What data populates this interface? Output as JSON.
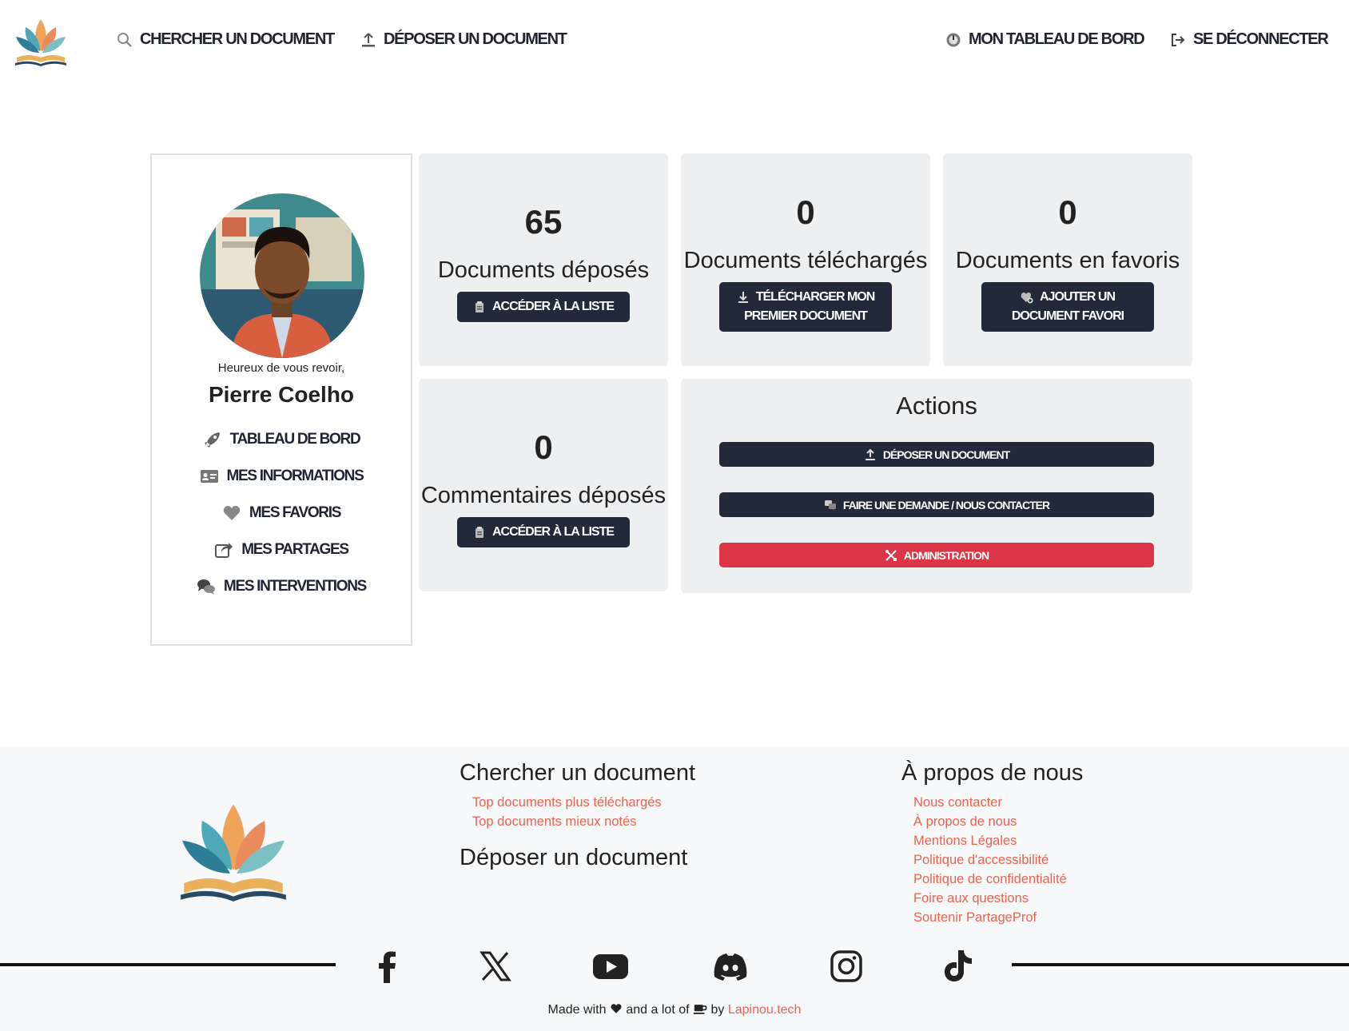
{
  "nav": {
    "search": "CHERCHER UN DOCUMENT",
    "upload": "DÉPOSER UN DOCUMENT",
    "dashboard": "MON TABLEAU DE BORD",
    "logout": "SE DÉCONNECTER"
  },
  "profile": {
    "greeting": "Heureux de vous revoir,",
    "name": "Pierre Coelho",
    "menu": [
      "TABLEAU DE BORD",
      "MES INFORMATIONS",
      "MES FAVORIS",
      "MES PARTAGES",
      "MES INTERVENTIONS"
    ]
  },
  "stats": {
    "uploaded": {
      "count": "65",
      "label": "Documents déposés",
      "button": "ACCÉDER À LA LISTE"
    },
    "downloaded": {
      "count": "0",
      "label": "Documents téléchargés",
      "button_line1": "TÉLÉCHARGER MON",
      "button_line2": "PREMIER DOCUMENT"
    },
    "favorites": {
      "count": "0",
      "label": "Documents en favoris",
      "button_line1": "AJOUTER UN",
      "button_line2": "DOCUMENT FAVORI"
    },
    "comments": {
      "count": "0",
      "label": "Commentaires déposés",
      "button": "ACCÉDER À LA LISTE"
    }
  },
  "actions": {
    "title": "Actions",
    "upload": "DÉPOSER UN DOCUMENT",
    "contact": "FAIRE UNE DEMANDE / NOUS CONTACTER",
    "admin": "ADMINISTRATION"
  },
  "footer": {
    "search_heading": "Chercher un document",
    "search_links": [
      "Top documents plus téléchargés",
      "Top documents mieux notés"
    ],
    "upload_heading": "Déposer un document",
    "about_heading": "À propos de nous",
    "about_links": [
      "Nous contacter",
      "À propos de nous",
      "Mentions Légales",
      "Politique d'accessibilité",
      "Politique de confidentialité",
      "Foire aux questions",
      "Soutenir PartageProf"
    ],
    "social_icons": [
      "facebook-icon",
      "x-icon",
      "youtube-icon",
      "discord-icon",
      "instagram-icon",
      "tiktok-icon"
    ],
    "made_prefix": "Made with",
    "made_middle": "and a lot of",
    "made_by": "by",
    "made_author": "Lapinou.tech"
  },
  "colors": {
    "dark": "#222938",
    "danger": "#dc3545",
    "link": "#e8634f",
    "card": "#eeeff1"
  }
}
